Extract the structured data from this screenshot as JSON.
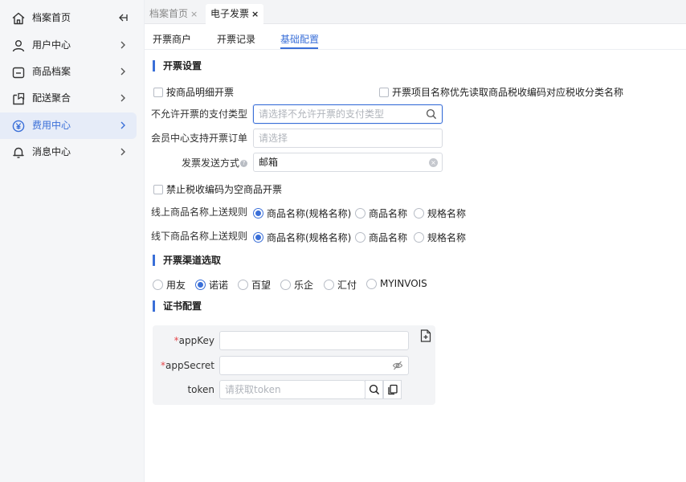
{
  "sidebar": {
    "items": [
      {
        "label": "档案首页",
        "icon": "home-icon"
      },
      {
        "label": "用户中心",
        "icon": "user-icon"
      },
      {
        "label": "商品档案",
        "icon": "product-icon"
      },
      {
        "label": "配送聚合",
        "icon": "delivery-icon"
      },
      {
        "label": "费用中心",
        "icon": "yen-icon"
      },
      {
        "label": "消息中心",
        "icon": "bell-icon"
      }
    ],
    "active_index": 4,
    "collapse_icon": "collapse-left-icon"
  },
  "tabs": [
    {
      "label": "档案首页",
      "close": "×"
    },
    {
      "label": "电子发票",
      "close": "×"
    }
  ],
  "subtabs": [
    {
      "label": "开票商户"
    },
    {
      "label": "开票记录"
    },
    {
      "label": "基础配置"
    }
  ],
  "invoice_settings": {
    "title": "开票设置",
    "by_detail_label": "按商品明细开票",
    "tax_name_priority_label": "开票项目名称优先读取商品税收编码对应税收分类名称",
    "disallow_pay_label": "不允许开票的支付类型",
    "disallow_pay_placeholder": "请选择不允许开票的支付类型",
    "member_center_label": "会员中心支持开票订单",
    "member_center_placeholder": "请选择",
    "send_method_label": "发票发送方式",
    "send_method_help": "?",
    "send_method_value": "邮箱",
    "send_method_clear": "×",
    "forbid_empty_tax_label": "禁止税收编码为空商品开票",
    "online_rule_label": "线上商品名称上送规则",
    "offline_rule_label": "线下商品名称上送规则",
    "name_rule_options": [
      "商品名称(规格名称)",
      "商品名称",
      "规格名称"
    ]
  },
  "channel": {
    "title": "开票渠道选取",
    "options": [
      "用友",
      "诺诺",
      "百望",
      "乐企",
      "汇付",
      "MYINVOIS"
    ],
    "selected": "诺诺"
  },
  "cert": {
    "title": "证书配置",
    "required_mark": "*",
    "appkey_label": "appKey",
    "appsecret_label": "appSecret",
    "token_label": "token",
    "token_placeholder": "请获取token"
  },
  "colors": {
    "accent": "#3a6fd8",
    "required": "#e5484d"
  }
}
